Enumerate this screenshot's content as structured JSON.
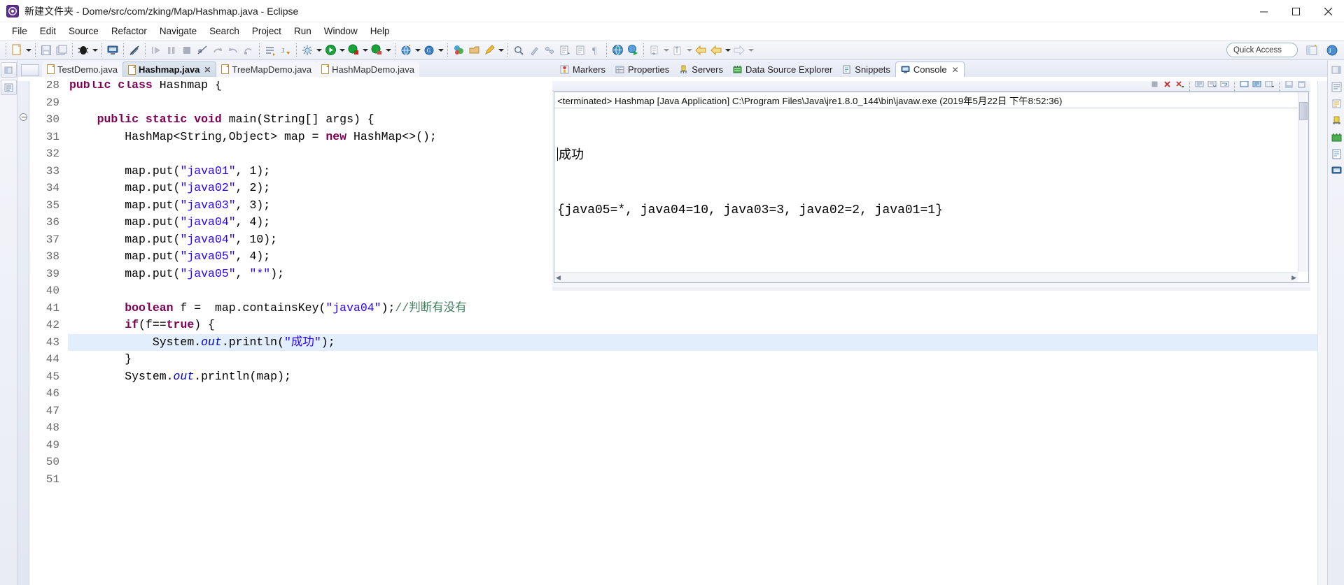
{
  "window": {
    "title": "新建文件夹 - Dome/src/com/zking/Map/Hashmap.java - Eclipse",
    "app_icon": "eclipse-icon",
    "minimize": "–",
    "maximize": "□",
    "close": "✕"
  },
  "menu": {
    "items": [
      "File",
      "Edit",
      "Source",
      "Refactor",
      "Navigate",
      "Search",
      "Project",
      "Run",
      "Window",
      "Help"
    ]
  },
  "toolbar": {
    "quick_access_placeholder": "Quick Access",
    "groups": [
      [
        "new-wizard-icon",
        "dropdown",
        "save-icon",
        "save-all-icon"
      ],
      [
        "debug-icon",
        "dropdown",
        "open-console-icon",
        "no-marker-icon"
      ],
      [
        "step-into-icon",
        "step-over-icon",
        "terminate-icon",
        "skip-breakpoints-icon",
        "step-return-icon",
        "resume-icon",
        "drop-to-frame-icon"
      ],
      [
        "new-java-project-icon",
        "new-class-icon"
      ],
      [
        "external-tools-icon",
        "dropdown",
        "run-icon",
        "dropdown",
        "debug-run-icon",
        "dropdown",
        "coverage-icon",
        "dropdown"
      ],
      [
        "new-web-icon",
        "dropdown",
        "new-java-ee-icon",
        "dropdown"
      ],
      [
        "open-type-icon",
        "open-task-icon",
        "pencil-icon",
        "dropdown"
      ],
      [
        "search-icon",
        "toggle-mark-occurrences-icon",
        "link-icon"
      ],
      [
        "next-annotation-icon",
        "previous-annotation-icon",
        "show-whitespace-icon"
      ],
      [
        "web-browser-icon",
        "run-as-server-icon"
      ],
      [
        "restore-icon",
        "dropdown",
        "previous-edit-icon",
        "dropdown"
      ],
      [
        "back-icon",
        "forward-icon",
        "dropdown",
        "next-icon",
        "dropdown"
      ]
    ],
    "perspective_buttons": [
      "open-perspective-icon",
      "java-ee-perspective-icon"
    ]
  },
  "editor": {
    "tabs": [
      {
        "label": "TestDemo.java",
        "active": false,
        "icon": "java-file-icon"
      },
      {
        "label": "Hashmap.java",
        "active": true,
        "icon": "java-file-icon",
        "close": "✕"
      },
      {
        "label": "TreeMapDemo.java",
        "active": false,
        "icon": "java-file-icon"
      },
      {
        "label": "HashMapDemo.java",
        "active": false,
        "icon": "java-file-icon"
      }
    ],
    "line_numbers": [
      28,
      29,
      30,
      31,
      32,
      33,
      34,
      35,
      36,
      37,
      38,
      39,
      40,
      41,
      42,
      43,
      44,
      45,
      46,
      47,
      48,
      49,
      50,
      51
    ],
    "highlighted_line": 43,
    "folding_marker_line": 30,
    "lines": [
      {
        "n": 28,
        "html": "<span class='kw'>public class</span> <span class='bl'>Hashmap</span> {"
      },
      {
        "n": 29,
        "html": ""
      },
      {
        "n": 30,
        "html": "    <span class='kw'>public static void</span> main(String[] args) {"
      },
      {
        "n": 31,
        "html": "        HashMap&lt;String,Object&gt; map = <span class='kw'>new</span> HashMap&lt;&gt;();"
      },
      {
        "n": 32,
        "html": ""
      },
      {
        "n": 33,
        "html": "        map.put(<span class='str'>\"java01\"</span>, 1);"
      },
      {
        "n": 34,
        "html": "        map.put(<span class='str'>\"java02\"</span>, 2);"
      },
      {
        "n": 35,
        "html": "        map.put(<span class='str'>\"java03\"</span>, 3);"
      },
      {
        "n": 36,
        "html": "        map.put(<span class='str'>\"java04\"</span>, 4);"
      },
      {
        "n": 37,
        "html": "        map.put(<span class='str'>\"java04\"</span>, 10);"
      },
      {
        "n": 38,
        "html": "        map.put(<span class='str'>\"java05\"</span>, 4);"
      },
      {
        "n": 39,
        "html": "        map.put(<span class='str'>\"java05\"</span>, <span class='str'>\"*\"</span>);"
      },
      {
        "n": 40,
        "html": ""
      },
      {
        "n": 41,
        "html": "        <span class='kw'>boolean</span> f =  map.containsKey(<span class='str'>\"java04\"</span>);<span class='cmt'>//判断有没有</span>"
      },
      {
        "n": 42,
        "html": "        <span class='kw'>if</span>(f==<span class='kw'>true</span>) {"
      },
      {
        "n": 43,
        "html": "            System.<span class='it'>out</span>.println(<span class='str'>\"成功\"</span>);"
      },
      {
        "n": 44,
        "html": "        }"
      },
      {
        "n": 45,
        "html": "        System.<span class='it'>out</span>.println(map);"
      },
      {
        "n": 46,
        "html": ""
      },
      {
        "n": 47,
        "html": ""
      },
      {
        "n": 48,
        "html": ""
      },
      {
        "n": 49,
        "html": ""
      },
      {
        "n": 50,
        "html": ""
      },
      {
        "n": 51,
        "html": ""
      }
    ]
  },
  "console": {
    "tabs": [
      {
        "label": "Markers",
        "icon": "markers-icon",
        "active": false
      },
      {
        "label": "Properties",
        "icon": "properties-icon",
        "active": false
      },
      {
        "label": "Servers",
        "icon": "servers-icon",
        "active": false
      },
      {
        "label": "Data Source Explorer",
        "icon": "data-source-icon",
        "active": false
      },
      {
        "label": "Snippets",
        "icon": "snippets-icon",
        "active": false
      },
      {
        "label": "Console",
        "icon": "console-icon",
        "active": true,
        "close": "✕"
      }
    ],
    "toolbar_buttons": [
      "terminate-icon",
      "remove-launch-icon",
      "remove-all-terminated-icon",
      "open-console-icon",
      "scroll-lock-icon",
      "word-wrap-icon",
      "pin-console-icon",
      "display-selected-console-icon",
      "open-console-dropdown-icon",
      "minimize-icon",
      "maximize-icon"
    ],
    "status_line": "<terminated> Hashmap [Java Application] C:\\Program Files\\Java\\jre1.8.0_144\\bin\\javaw.exe (2019年5月22日 下午8:52:36)",
    "output_lines": [
      "成功",
      "{java05=*, java04=10, java03=3, java02=2, java01=1}"
    ]
  },
  "colors": {
    "keyword": "#7f0055",
    "string": "#2a00ff",
    "comment": "#3f7f5f",
    "highlight_line": "#e2eefb",
    "toolbar_bg": "#eceef6",
    "tab_active": "#cfdbe8"
  }
}
